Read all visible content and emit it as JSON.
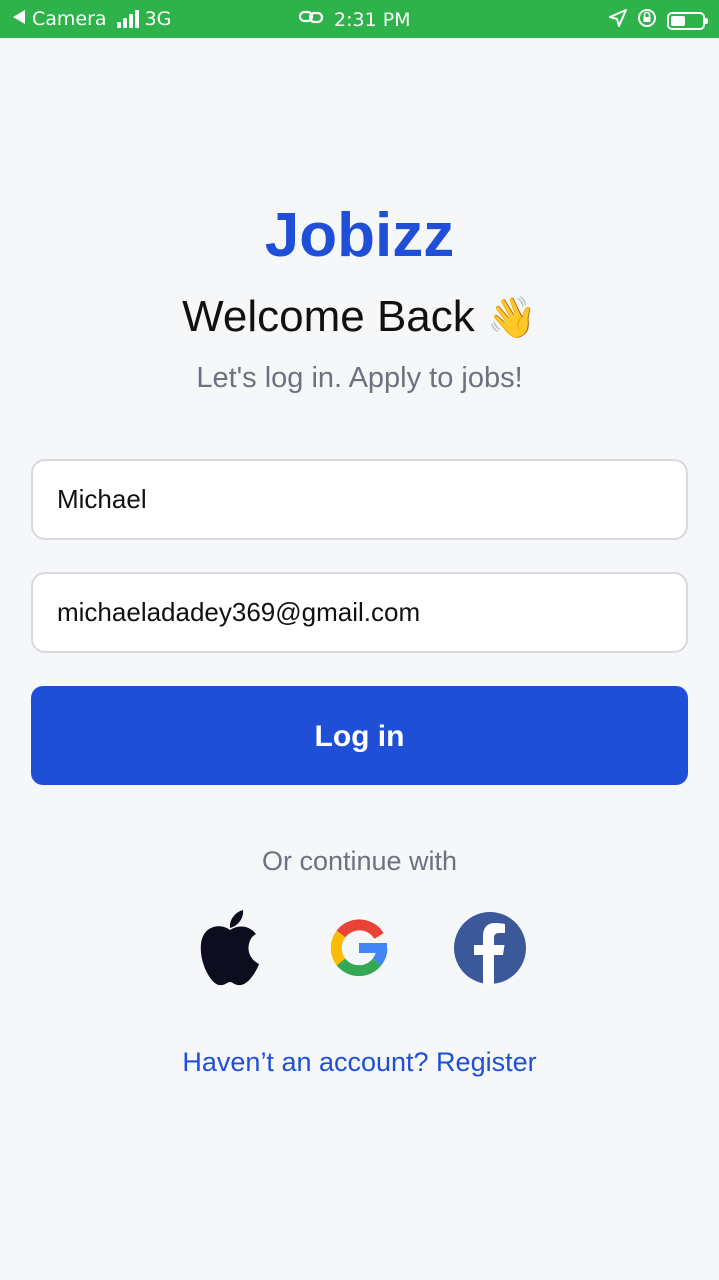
{
  "status_bar": {
    "back_app": "Camera",
    "network": "3G",
    "time": "2:31 PM",
    "icons": [
      "signal-icon",
      "link-icon",
      "location-icon",
      "rotation-lock-icon",
      "battery-icon"
    ],
    "background_color": "#2db34a"
  },
  "brand": {
    "name": "Jobizz",
    "color": "#1f4fd6"
  },
  "heading": {
    "title": "Welcome Back",
    "emoji": "👋",
    "subtitle": "Let's log in. Apply to jobs!"
  },
  "form": {
    "name_value": "Michael",
    "email_value": "michaeladadey369@gmail.com",
    "login_label": "Log in"
  },
  "social": {
    "label": "Or continue with",
    "providers": [
      "apple-icon",
      "google-icon",
      "facebook-icon"
    ]
  },
  "register": {
    "prompt": "Haven’t an account? Register"
  }
}
